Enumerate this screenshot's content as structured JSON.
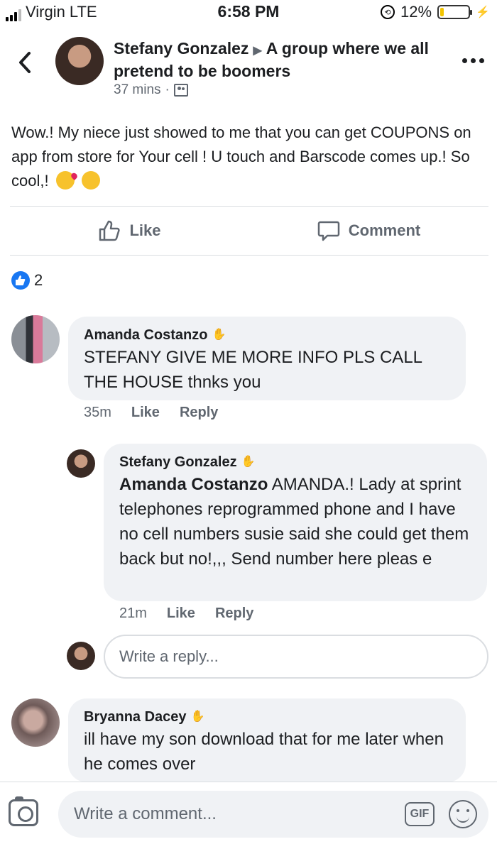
{
  "status_bar": {
    "carrier": "Virgin",
    "network": "LTE",
    "time": "6:58 PM",
    "battery": "12%",
    "battery_level": 0.12,
    "battery_color": "#f2c400"
  },
  "header": {
    "author": "Stefany Gonzalez",
    "group": "A group where we all pretend to be boomers",
    "time": "37 mins",
    "separator": "·",
    "audience_icon": "group-icon"
  },
  "post": {
    "text": "Wow.! My niece just showed to me that you can get COUPONS on app from store for Your cell ! U touch and Barscode comes up.! So cool,!",
    "emojis": [
      "kissing-face-heart-emoji",
      "rolling-laughing-emoji"
    ]
  },
  "actions": {
    "like_label": "Like",
    "comment_label": "Comment"
  },
  "reactions": {
    "count": "2",
    "icon": "like-icon",
    "color": "#1877f2"
  },
  "comments": [
    {
      "author": "Amanda Costanzo",
      "text": "STEFANY GIVE ME MORE INFO PLS CALL THE HOUSE thnks you",
      "time": "35m",
      "like": "Like",
      "reply": "Reply"
    },
    {
      "author": "Stefany Gonzalez",
      "mention": "Amanda Costanzo",
      "text": " AMANDA.! Lady at sprint telephones reprogrammed phone and I have no cell numbers susie said she could get them back but no!,,, Send number here pleas e",
      "time": "21m",
      "like": "Like",
      "reply": "Reply"
    },
    {
      "author": "Bryanna Dacey",
      "text": "ill have my son download that for me later when he comes over"
    }
  ],
  "reply_input": {
    "placeholder": "Write a reply..."
  },
  "comment_bar": {
    "placeholder": "Write a comment...",
    "gif_label": "GIF"
  }
}
